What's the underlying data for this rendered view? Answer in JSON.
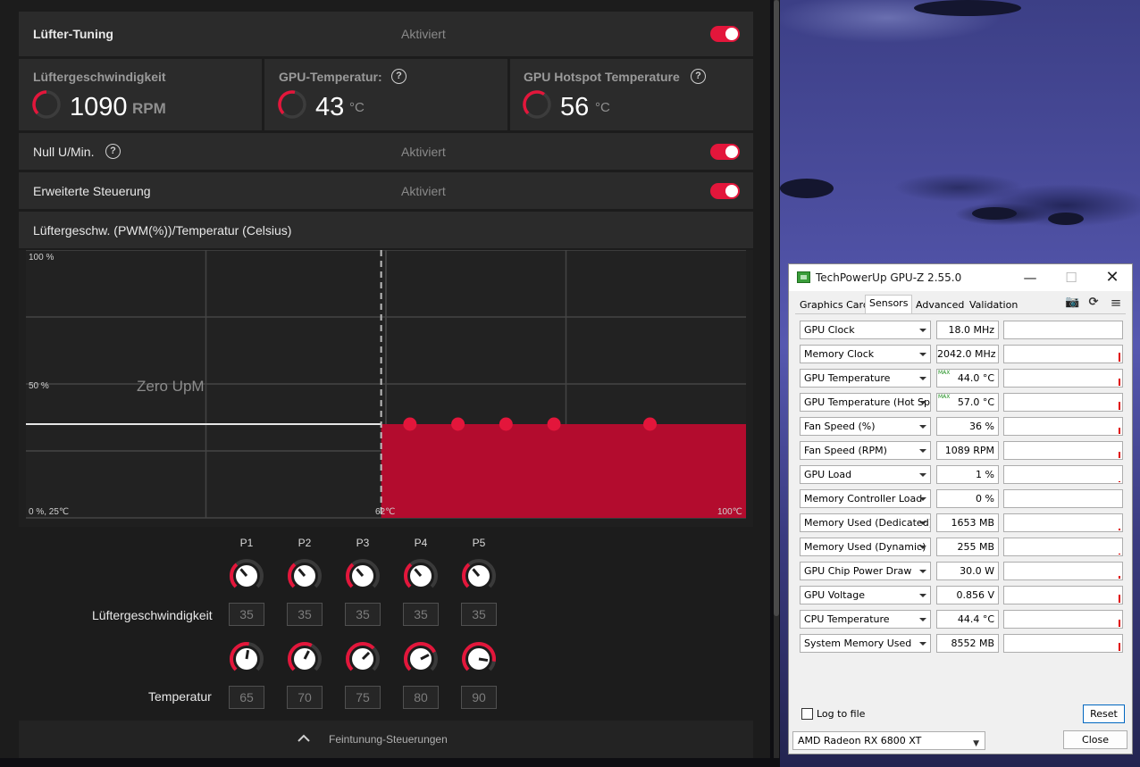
{
  "amd": {
    "fan_tuning": {
      "label": "Lüfter-Tuning",
      "status": "Aktiviert",
      "enabled": true
    },
    "metrics": {
      "fan_speed": {
        "label": "Lüftergeschwindigkeit",
        "value": "1090",
        "unit": "RPM",
        "level": 0.35
      },
      "gpu_temp": {
        "label": "GPU-Temperatur:",
        "value": "43",
        "unit": "°C",
        "level": 0.43
      },
      "hotspot_temp": {
        "label": "GPU Hotspot Temperature",
        "value": "56",
        "unit": "°C",
        "level": 0.56
      }
    },
    "zero_rpm": {
      "label": "Null U/Min.",
      "status": "Aktiviert",
      "enabled": true
    },
    "advanced": {
      "label": "Erweiterte Steuerung",
      "status": "Aktiviert",
      "enabled": true
    },
    "curve_header": "Lüftergeschw. (PWM(%))/Temperatur (Celsius)",
    "chart": {
      "y_top": "100 %",
      "y_mid": "50 %",
      "origin": "0 %, 25℃",
      "x_mid": "62℃",
      "x_max": "100℃",
      "zero_label": "Zero UpM"
    },
    "points": {
      "fan_row_label": "Lüftergeschwindigkeit",
      "temp_row_label": "Temperatur",
      "names": [
        "P1",
        "P2",
        "P3",
        "P4",
        "P5"
      ],
      "fan": [
        "35",
        "35",
        "35",
        "35",
        "35"
      ],
      "temp": [
        "65",
        "70",
        "75",
        "80",
        "90"
      ]
    },
    "fine_tuning": "Feintunung-Steuerungen"
  },
  "chart_data": {
    "type": "area",
    "title": "Lüftergeschw. (PWM(%))/Temperatur (Celsius)",
    "xlabel": "",
    "ylabel": "",
    "xlim": [
      25,
      100
    ],
    "ylim": [
      0,
      100
    ],
    "zero_rpm_until": 62,
    "series": [
      {
        "x": [
          65,
          70,
          75,
          80,
          90
        ],
        "y": [
          35,
          35,
          35,
          35,
          35
        ]
      }
    ]
  },
  "gpuz": {
    "title": "TechPowerUp GPU-Z 2.55.0",
    "tabs": [
      "Graphics Card",
      "Sensors",
      "Advanced",
      "Validation"
    ],
    "active_tab": "Sensors",
    "sensors": [
      {
        "name": "GPU Clock",
        "value": "18.0 MHz",
        "max": "",
        "bar": 0
      },
      {
        "name": "Memory Clock",
        "value": "2042.0 MHz",
        "max": "",
        "bar": 0.6
      },
      {
        "name": "GPU Temperature",
        "value": "44.0 °C",
        "max": "MAX",
        "bar": 0.45
      },
      {
        "name": "GPU Temperature (Hot Spot)",
        "value": "57.0 °C",
        "max": "MAX",
        "bar": 0.5
      },
      {
        "name": "Fan Speed (%)",
        "value": "36 %",
        "max": "",
        "bar": 0.4
      },
      {
        "name": "Fan Speed (RPM)",
        "value": "1089 RPM",
        "max": "",
        "bar": 0.4
      },
      {
        "name": "GPU Load",
        "value": "1 %",
        "max": "",
        "bar": 0.05
      },
      {
        "name": "Memory Controller Load",
        "value": "0 %",
        "max": "",
        "bar": 0
      },
      {
        "name": "Memory Used (Dedicated)",
        "value": "1653 MB",
        "max": "",
        "bar": 0.12
      },
      {
        "name": "Memory Used (Dynamic)",
        "value": "255 MB",
        "max": "",
        "bar": 0.05
      },
      {
        "name": "GPU Chip Power Draw",
        "value": "30.0 W",
        "max": "",
        "bar": 0.15
      },
      {
        "name": "GPU Voltage",
        "value": "0.856 V",
        "max": "",
        "bar": 0.55
      },
      {
        "name": "CPU Temperature",
        "value": "44.4 °C",
        "max": "",
        "bar": 0.45
      },
      {
        "name": "System Memory Used",
        "value": "8552 MB",
        "max": "",
        "bar": 0.5
      }
    ],
    "log_to_file": "Log to file",
    "reset": "Reset",
    "card": "AMD Radeon RX 6800 XT",
    "close": "Close"
  },
  "colors": {
    "accent": "#e3163b",
    "curve_fill": "#b30c2e",
    "panel": "#2b2b2b"
  }
}
